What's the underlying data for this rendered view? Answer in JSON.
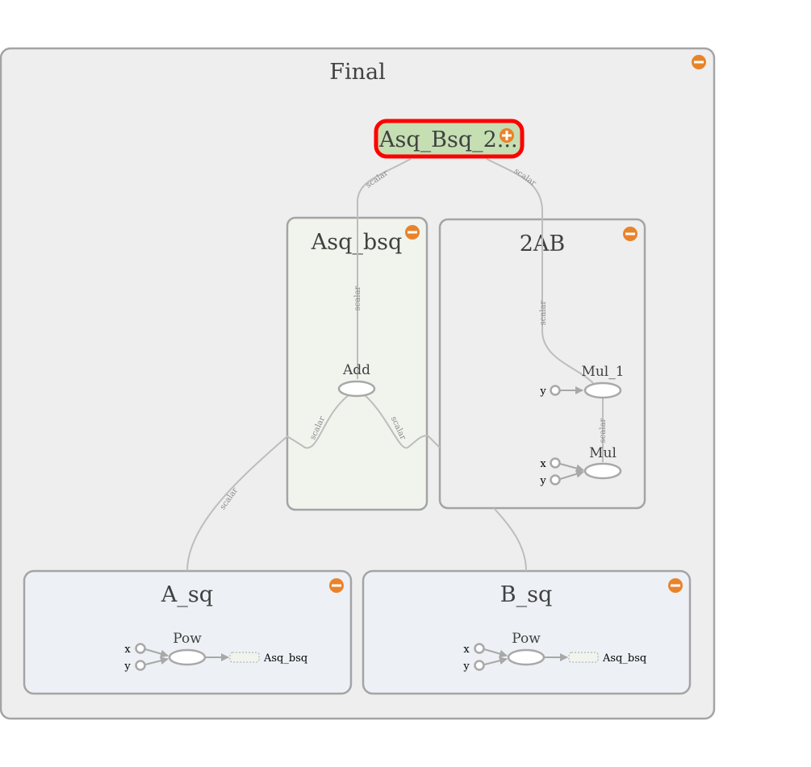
{
  "graph": {
    "final": {
      "title": "Final",
      "toggle_icon": "minus-circle"
    },
    "selected_node": {
      "label": "Asq_Bsq_2...",
      "toggle_icon": "plus-circle",
      "fill": "#c5dfb3",
      "highlight": "#ff0000"
    },
    "asq_bsq": {
      "title": "Asq_bsq",
      "toggle_icon": "minus-circle",
      "op_label": "Add"
    },
    "two_ab": {
      "title": "2AB",
      "toggle_icon": "minus-circle",
      "mul1_label": "Mul_1",
      "mul_label": "Mul",
      "y_port": "y",
      "x_port": "x"
    },
    "a_sq": {
      "title": "A_sq",
      "toggle_icon": "minus-circle",
      "op_label": "Pow",
      "x_port": "x",
      "y_port": "y",
      "output_label": "Asq_bsq"
    },
    "b_sq": {
      "title": "B_sq",
      "toggle_icon": "minus-circle",
      "op_label": "Pow",
      "x_port": "x",
      "y_port": "y",
      "output_label": "Asq_bsq"
    },
    "edge_label": "scalar",
    "colors": {
      "toggle": "#e9832a",
      "group_fill": "#eeeeee",
      "green_group": "#f0f4ed",
      "blue_group": "#edf0f4",
      "border": "#a4a4a6"
    }
  }
}
